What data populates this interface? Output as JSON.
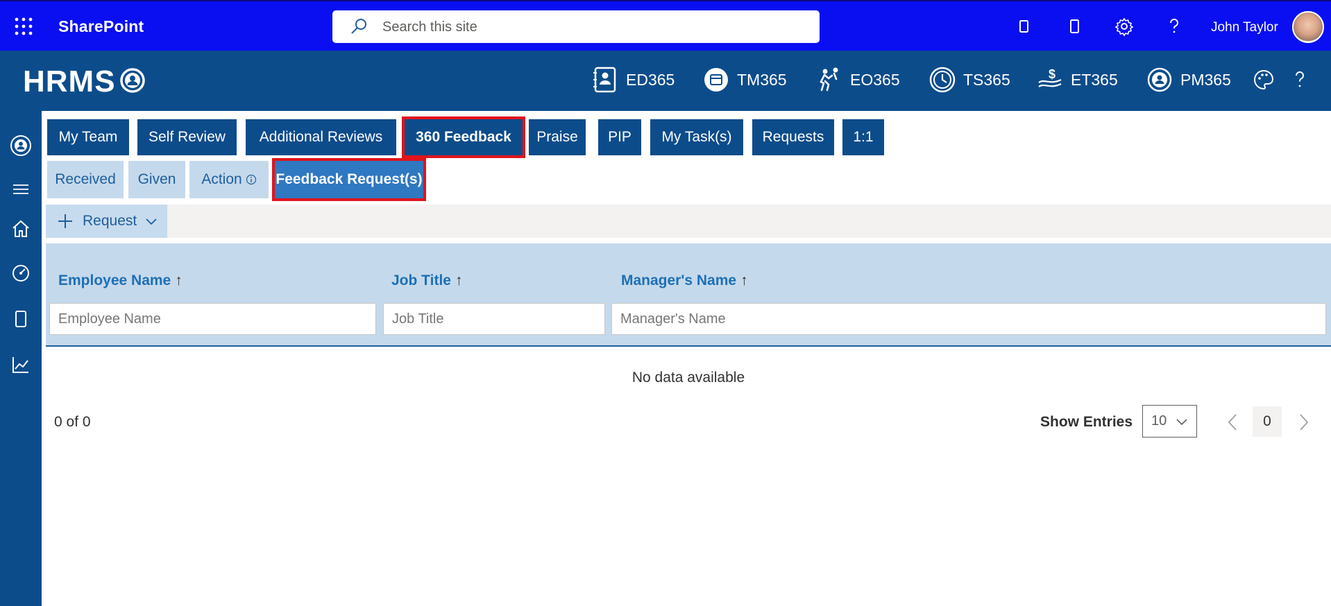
{
  "suitebar": {
    "title": "SharePoint",
    "search_placeholder": "Search this site",
    "user_name": "John Taylor",
    "icons": [
      "waffle-icon",
      "search-icon",
      "document-icon",
      "tablet-icon",
      "gear-icon",
      "help-icon"
    ],
    "bg_color": "#0a0ff2"
  },
  "appbar": {
    "logo": "HRMS",
    "apps": [
      {
        "label": "ED365",
        "icon": "employee-directory-icon"
      },
      {
        "label": "TM365",
        "icon": "calendar-chat-icon"
      },
      {
        "label": "EO365",
        "icon": "onboarding-icon"
      },
      {
        "label": "TS365",
        "icon": "clock-icon"
      },
      {
        "label": "ET365",
        "icon": "expense-icon"
      },
      {
        "label": "PM365",
        "icon": "performance-icon"
      }
    ],
    "bg_color": "#0d4c8b"
  },
  "rail": {
    "icons": [
      "profile-icon",
      "menu-icon",
      "home-icon",
      "dashboard-icon",
      "document-icon",
      "chart-icon"
    ]
  },
  "tabs": [
    {
      "label": "My Team"
    },
    {
      "label": "Self Review"
    },
    {
      "label": "Additional Reviews"
    },
    {
      "label": "360 Feedback",
      "active": true
    },
    {
      "label": "Praise"
    },
    {
      "label": "PIP"
    },
    {
      "label": "My Task(s)"
    },
    {
      "label": "Requests"
    },
    {
      "label": "1:1"
    }
  ],
  "subtabs": [
    {
      "label": "Received"
    },
    {
      "label": "Given"
    },
    {
      "label": "Action"
    },
    {
      "label": "Feedback Request(s)",
      "active": true
    }
  ],
  "command": {
    "request_label": "Request"
  },
  "table": {
    "columns": [
      {
        "label": "Employee Name",
        "sort": "↑",
        "placeholder": "Employee Name"
      },
      {
        "label": "Job Title",
        "sort": "↑",
        "placeholder": "Job Title"
      },
      {
        "label": "Manager's Name",
        "sort": "↑",
        "placeholder": "Manager's Name"
      }
    ],
    "empty_text": "No data available"
  },
  "pagination": {
    "count_text": "0 of 0",
    "show_entries_label": "Show Entries",
    "entries_value": "10",
    "current_page": "0"
  },
  "colors": {
    "accent": "#0d4c8b",
    "highlight_border": "#e0141c",
    "subtab_bg": "#c5d9ec",
    "active_subtab_bg": "#2f78c2"
  }
}
